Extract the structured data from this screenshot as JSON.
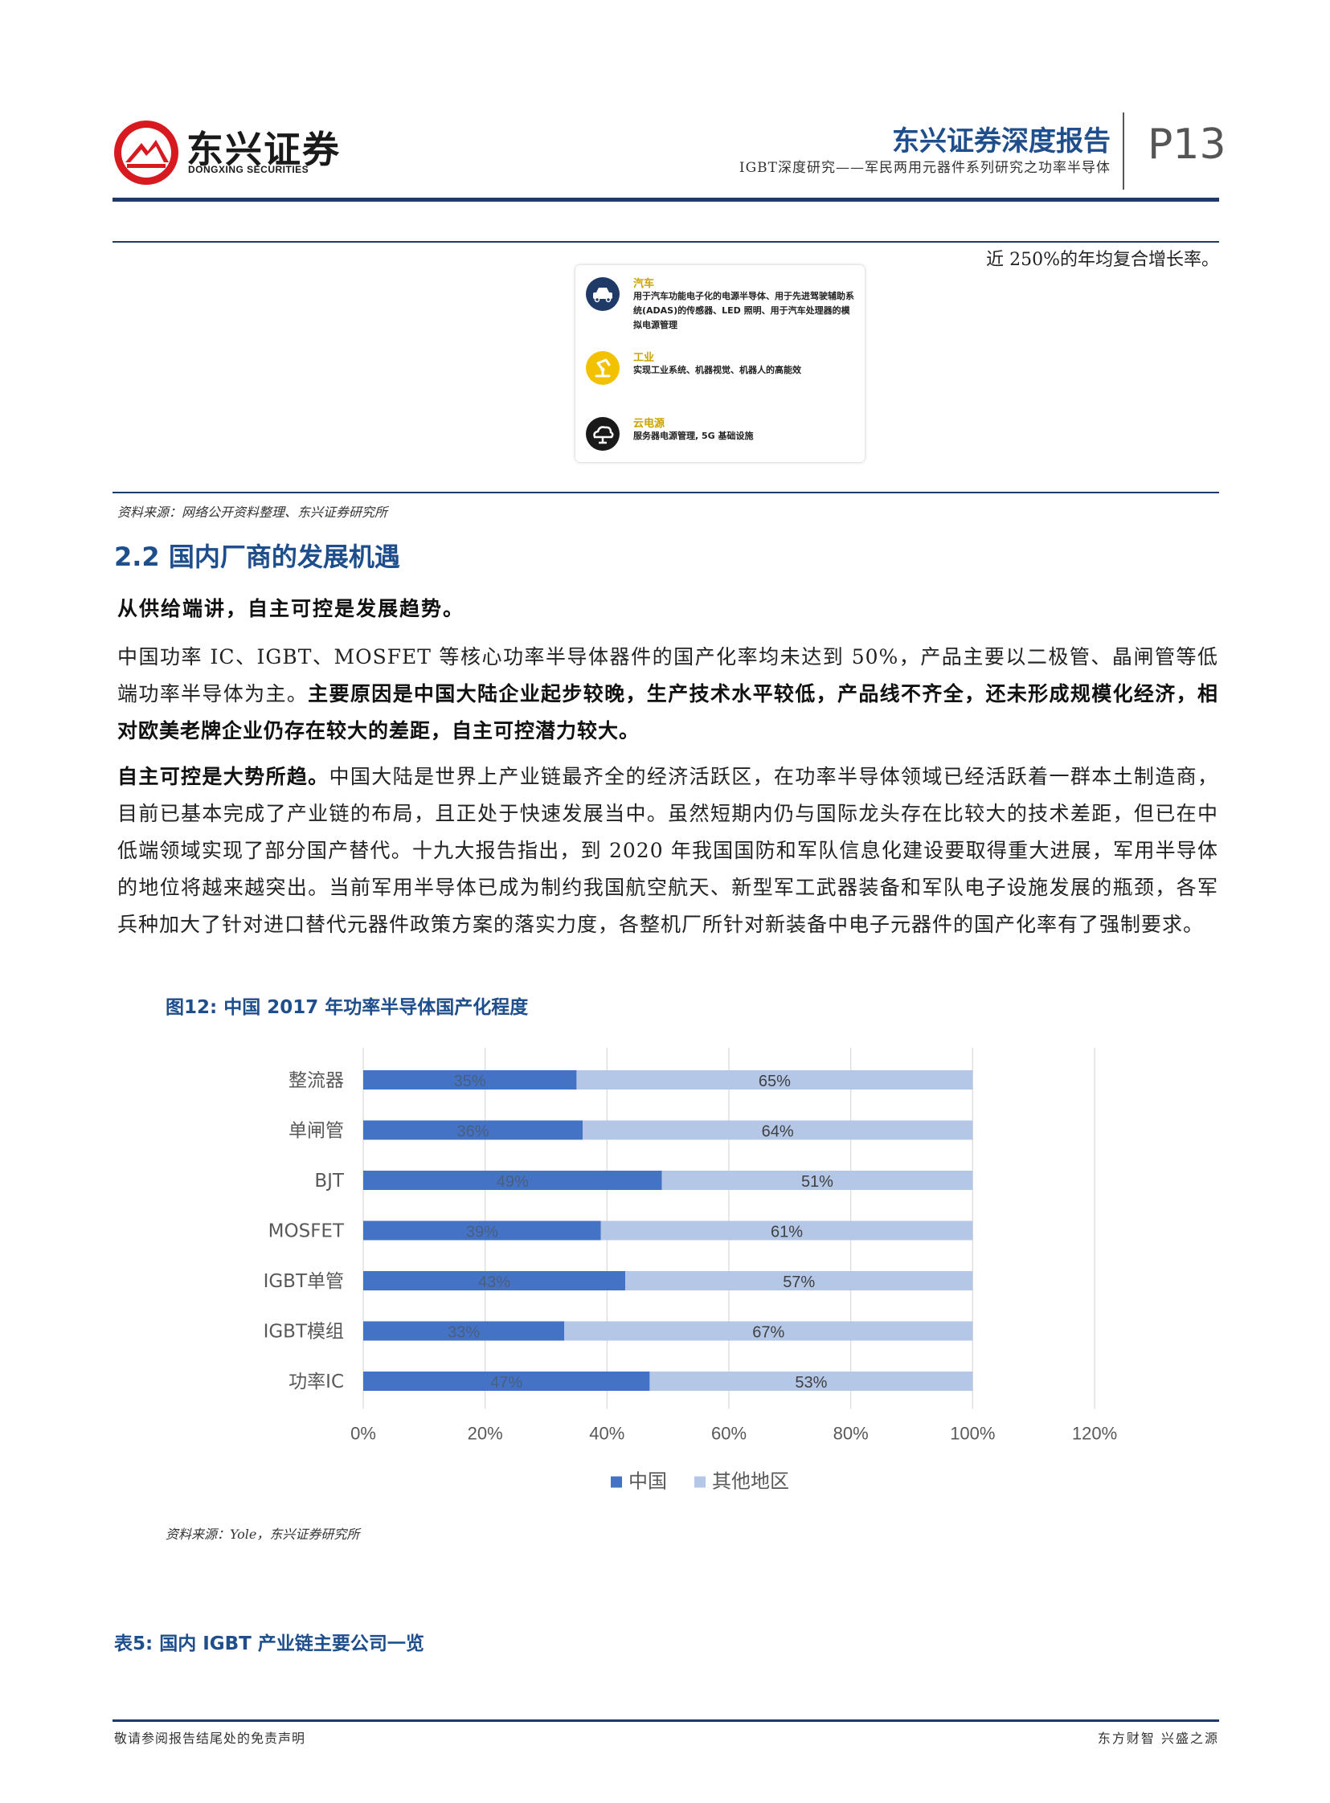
{
  "header": {
    "logo_cn": "东兴证券",
    "logo_en": "DONGXING SECURITIES",
    "report_title": "东兴证券深度报告",
    "report_subtitle": "IGBT深度研究——军民两用元器件系列研究之功率半导体",
    "page_number": "P13"
  },
  "fig11": {
    "top_text": "近 250%的年均复合增长率。",
    "items": [
      {
        "title": "汽车",
        "desc": "用于汽车功能电子化的电源半导体、用于先进驾驶辅助系统(ADAS)的传感器、LED 照明、用于汽车处理器的模拟电源管理",
        "icon": "car-icon"
      },
      {
        "title": "工业",
        "desc": "实现工业系统、机器视觉、机器人的高能效",
        "icon": "robot-arm-icon"
      },
      {
        "title": "云电源",
        "desc": "服务器电源管理, 5G 基础设施",
        "icon": "cloud-icon"
      }
    ],
    "source": "资料来源：网络公开资料整理、东兴证券研究所"
  },
  "section": {
    "title": "2.2 国内厂商的发展机遇",
    "lead": "从供给端讲，自主可控是发展趋势。",
    "para1_normal": "中国功率 IC、IGBT、MOSFET 等核心功率半导体器件的国产化率均未达到 50%，产品主要以二极管、晶闸管等低端功率半导体为主。",
    "para1_bold": "主要原因是中国大陆企业起步较晚，生产技术水平较低，产品线不齐全，还未形成规模化经济，相对欧美老牌企业仍存在较大的差距，自主可控潜力较大。",
    "para2_bold": "自主可控是大势所趋。",
    "para2_normal": "中国大陆是世界上产业链最齐全的经济活跃区，在功率半导体领域已经活跃着一群本土制造商，目前已基本完成了产业链的布局，且正处于快速发展当中。虽然短期内仍与国际龙头存在比较大的技术差距，但已在中低端领域实现了部分国产替代。十九大报告指出，到 2020 年我国国防和军队信息化建设要取得重大进展，军用半导体的地位将越来越突出。当前军用半导体已成为制约我国航空航天、新型军工武器装备和军队电子设施发展的瓶颈，各军兵种加大了针对进口替代元器件政策方案的落实力度，各整机厂所针对新装备中电子元器件的国产化率有了强制要求。"
  },
  "fig12": {
    "title": "图12: 中国 2017 年功率半导体国产化程度",
    "source": "资料来源：Yole，东兴证券研究所"
  },
  "chart_data": {
    "type": "bar",
    "orientation": "horizontal",
    "stacked": true,
    "title": "",
    "categories": [
      "整流器",
      "单闸管",
      "BJT",
      "MOSFET",
      "IGBT单管",
      "IGBT模组",
      "功率IC"
    ],
    "series": [
      {
        "name": "中国",
        "values": [
          35,
          36,
          49,
          39,
          43,
          33,
          47
        ],
        "labels": [
          "35%",
          "36%",
          "49%",
          "39%",
          "43%",
          "33%",
          "47%"
        ],
        "color": "#4472c4"
      },
      {
        "name": "其他地区",
        "values": [
          65,
          64,
          51,
          61,
          57,
          67,
          53
        ],
        "labels": [
          "65%",
          "64%",
          "51%",
          "61%",
          "57%",
          "67%",
          "53%"
        ],
        "color": "#b4c7e7"
      }
    ],
    "x_ticks": [
      "0%",
      "20%",
      "40%",
      "60%",
      "80%",
      "100%",
      "120%"
    ],
    "xlim": [
      0,
      120
    ],
    "grid": true,
    "legend_position": "bottom"
  },
  "table5": {
    "title": "表5: 国内 IGBT 产业链主要公司一览"
  },
  "footer": {
    "left": "敬请参阅报告结尾处的免责声明",
    "right": "东方财智 兴盛之源"
  }
}
